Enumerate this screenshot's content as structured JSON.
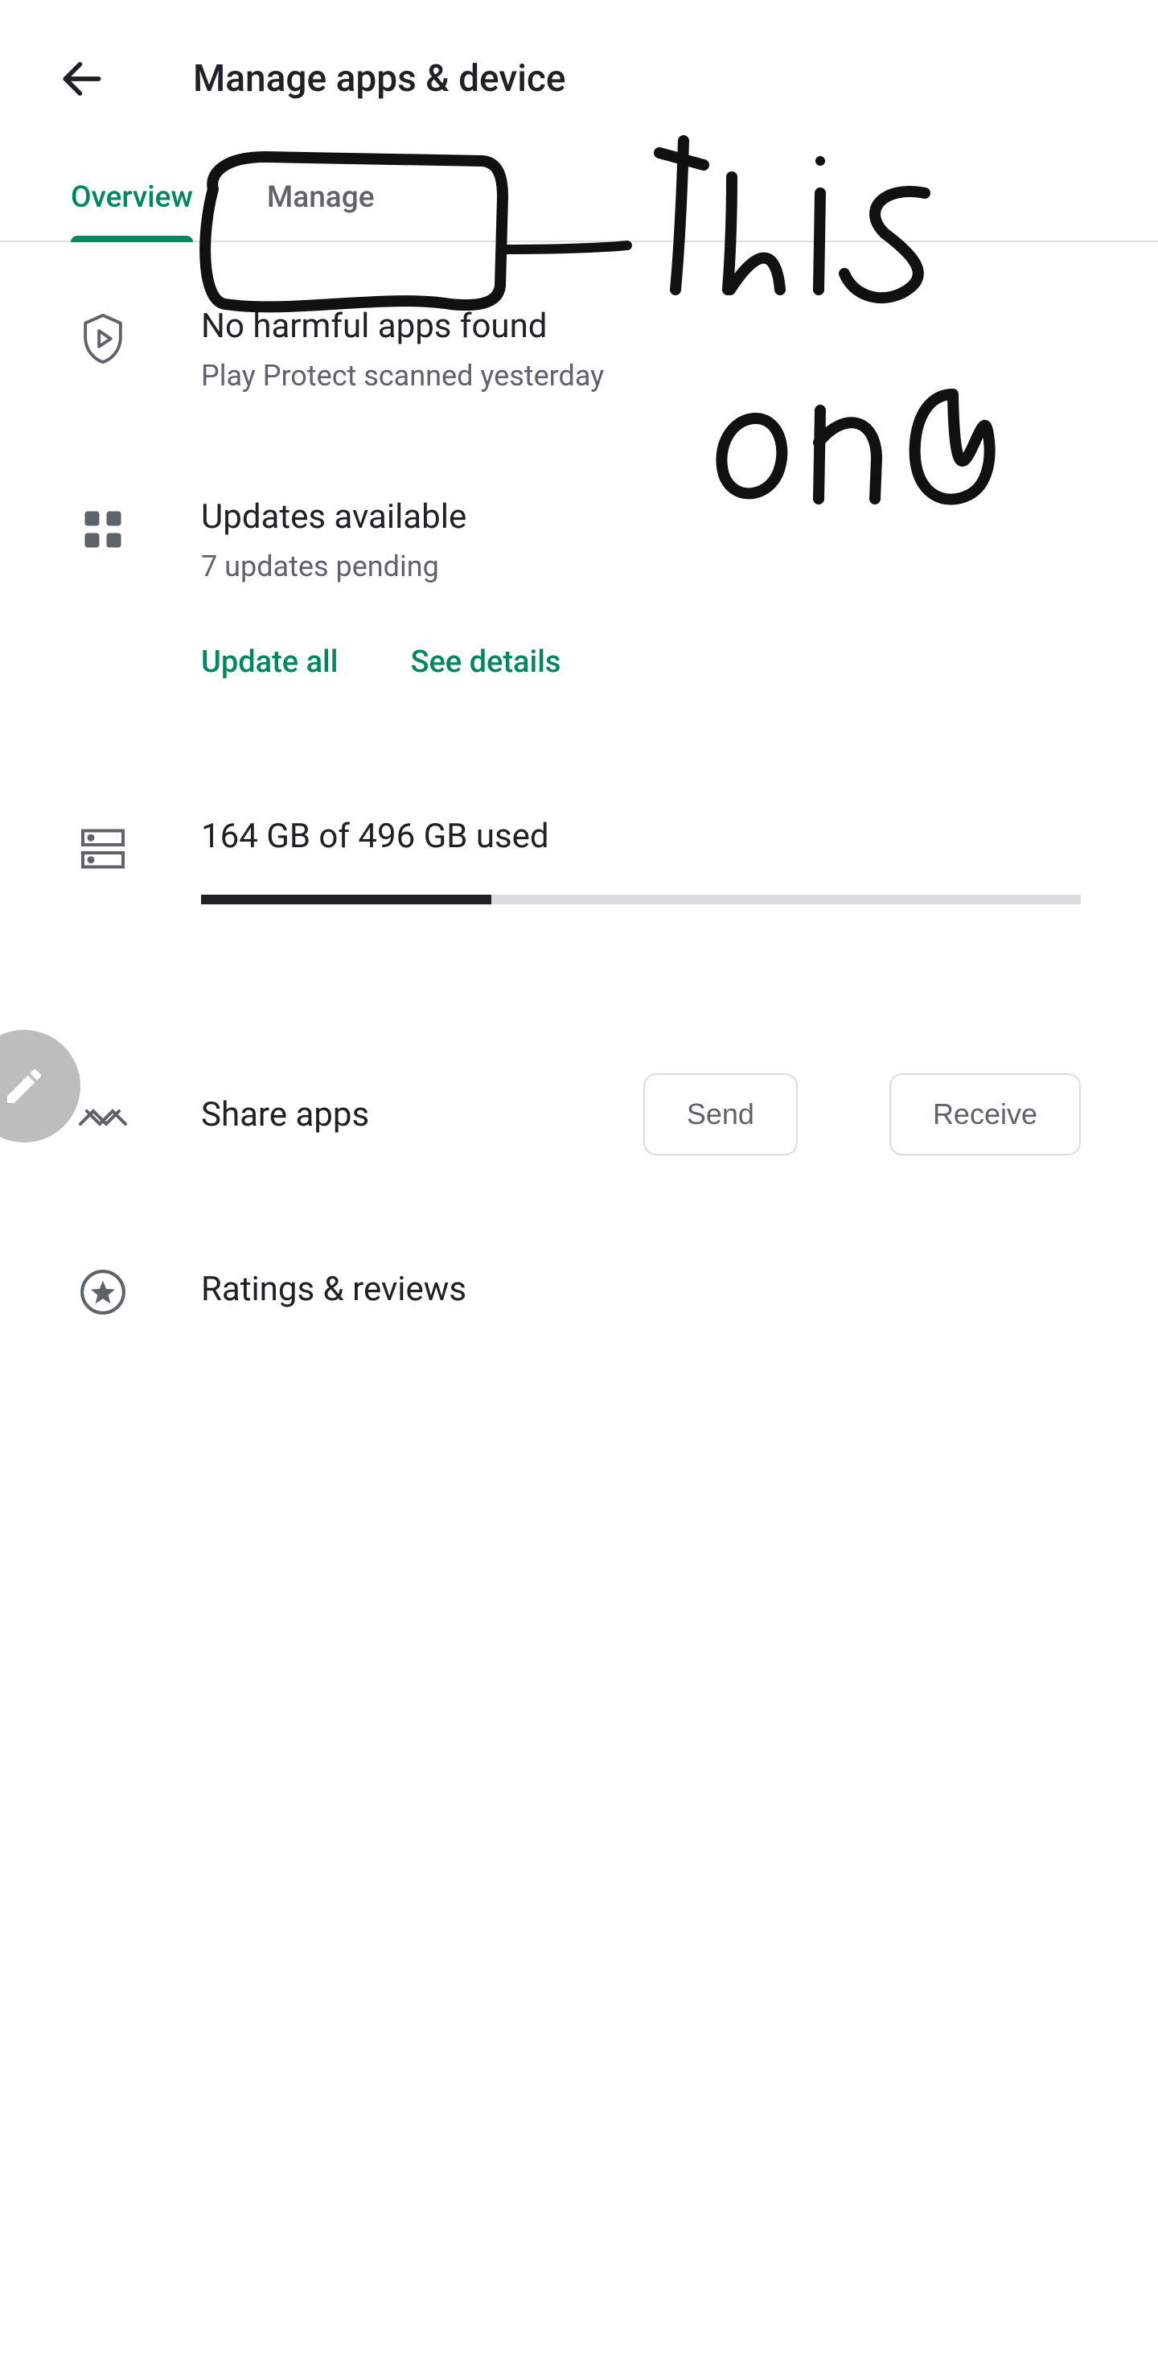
{
  "header": {
    "title": "Manage apps & device"
  },
  "tabs": {
    "overview": "Overview",
    "manage": "Manage"
  },
  "protect": {
    "title": "No harmful apps found",
    "sub": "Play Protect scanned yesterday"
  },
  "updates": {
    "title": "Updates available",
    "sub": "7 updates pending",
    "update_all": "Update all",
    "see_details": "See details"
  },
  "storage": {
    "text": "164 GB of 496 GB used",
    "percent": 33
  },
  "share": {
    "title": "Share apps",
    "send": "Send",
    "receive": "Receive"
  },
  "ratings": {
    "title": "Ratings & reviews"
  },
  "annotation": {
    "line1": "This",
    "line2": "one"
  },
  "colors": {
    "accent": "#01875f"
  }
}
